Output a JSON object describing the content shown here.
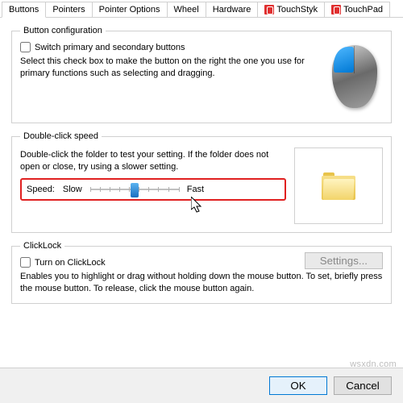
{
  "tabs": {
    "t0": "Buttons",
    "t1": "Pointers",
    "t2": "Pointer Options",
    "t3": "Wheel",
    "t4": "Hardware",
    "t5": "TouchStyk",
    "t6": "TouchPad"
  },
  "button_config": {
    "legend": "Button configuration",
    "switch_label": "Switch primary and secondary buttons",
    "desc": "Select this check box to make the button on the right the one you use for primary functions such as selecting and dragging."
  },
  "dblclick": {
    "legend": "Double-click speed",
    "desc": "Double-click the folder to test your setting. If the folder does not open or close, try using a slower setting.",
    "speed_label": "Speed:",
    "slow": "Slow",
    "fast": "Fast",
    "slider_pos_pct": 50
  },
  "clicklock": {
    "legend": "ClickLock",
    "turnon_label": "Turn on ClickLock",
    "settings_btn": "Settings...",
    "desc": "Enables you to highlight or drag without holding down the mouse button. To set, briefly press the mouse button. To release, click the mouse button again."
  },
  "footer": {
    "ok": "OK",
    "cancel": "Cancel"
  },
  "watermark": "wsxdn.com"
}
